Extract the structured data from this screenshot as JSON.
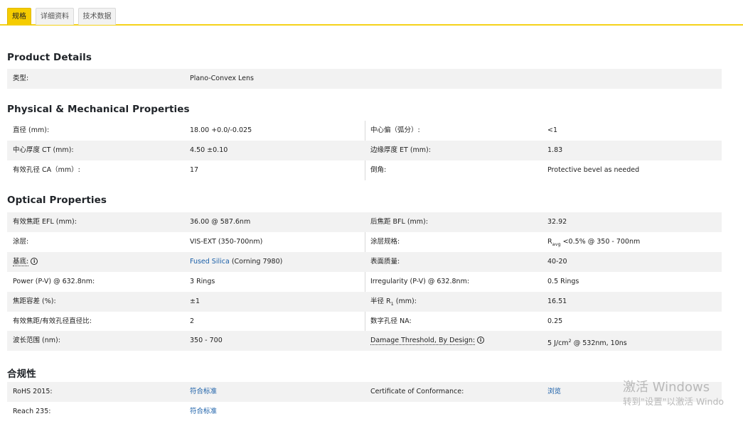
{
  "tabs": [
    "规格",
    "详细资料",
    "技术数据"
  ],
  "sections": {
    "product": "Product Details",
    "physical": "Physical & Mechanical Properties",
    "optical": "Optical Properties",
    "compliance": "合规性"
  },
  "product": {
    "type_label": "类型:",
    "type_value": "Plano-Convex Lens"
  },
  "physical": {
    "diameter_label": "直径 (mm):",
    "diameter_value": "18.00 +0.0/-0.025",
    "centering_label": "中心偏（弧分）:",
    "centering_value": "<1",
    "ct_label": "中心厚度 CT (mm):",
    "ct_value": "4.50 ±0.10",
    "et_label": "边缘厚度 ET (mm):",
    "et_value": "1.83",
    "ca_label": "有效孔径 CA（mm）:",
    "ca_value": "17",
    "bevel_label": "倒角:",
    "bevel_value": "Protective bevel as needed"
  },
  "optical": {
    "efl_label": "有效焦距 EFL (mm):",
    "efl_value": "36.00 @ 587.6nm",
    "bfl_label": "后焦距 BFL (mm):",
    "bfl_value": "32.92",
    "coating_label": "涂层:",
    "coating_value": "VIS-EXT (350-700nm)",
    "coating_spec_label": "涂层规格:",
    "coating_spec_R": "R",
    "coating_spec_sub": "avg",
    "coating_spec_rest": " <0.5% @ 350 - 700nm",
    "substrate_label": "基底:",
    "substrate_link": "Fused Silica",
    "substrate_rest": " (Corning 7980)",
    "surface_label": "表面质量:",
    "surface_value": "40-20",
    "power_label": "Power (P-V) @ 632.8nm:",
    "power_value": "3 Rings",
    "irregularity_label": "Irregularity (P-V) @ 632.8nm:",
    "irregularity_value": "0.5 Rings",
    "focal_tol_label": "焦距容差 (%):",
    "focal_tol_value": "±1",
    "radius_label_a": "半径 R",
    "radius_label_sub": "1",
    "radius_label_b": " (mm):",
    "radius_value": "16.51",
    "fnum_label": "有效焦距/有效孔径直径比:",
    "fnum_value": "2",
    "na_label": "数字孔径 NA:",
    "na_value": "0.25",
    "wavelength_label": "波长范围 (nm):",
    "wavelength_value": "350 - 700",
    "damage_label": "Damage Threshold, By Design:",
    "damage_value_a": "5 J/cm",
    "damage_value_sup": "2",
    "damage_value_b": " @ 532nm, 10ns"
  },
  "compliance": {
    "rohs_label": "RoHS 2015:",
    "rohs_value": "符合标准",
    "coc_label": "Certificate of Conformance:",
    "coc_value": "浏览",
    "reach_label": "Reach 235:",
    "reach_value": "符合标准"
  },
  "watermark": {
    "line1": "激活 Windows",
    "line2": "转到\"设置\"以激活 Windo"
  },
  "colors": {
    "accent": "#f5cc00",
    "link": "#1a5fa8",
    "row_shade": "#f2f2f2"
  },
  "icons": {
    "info": "info-circle-icon"
  }
}
